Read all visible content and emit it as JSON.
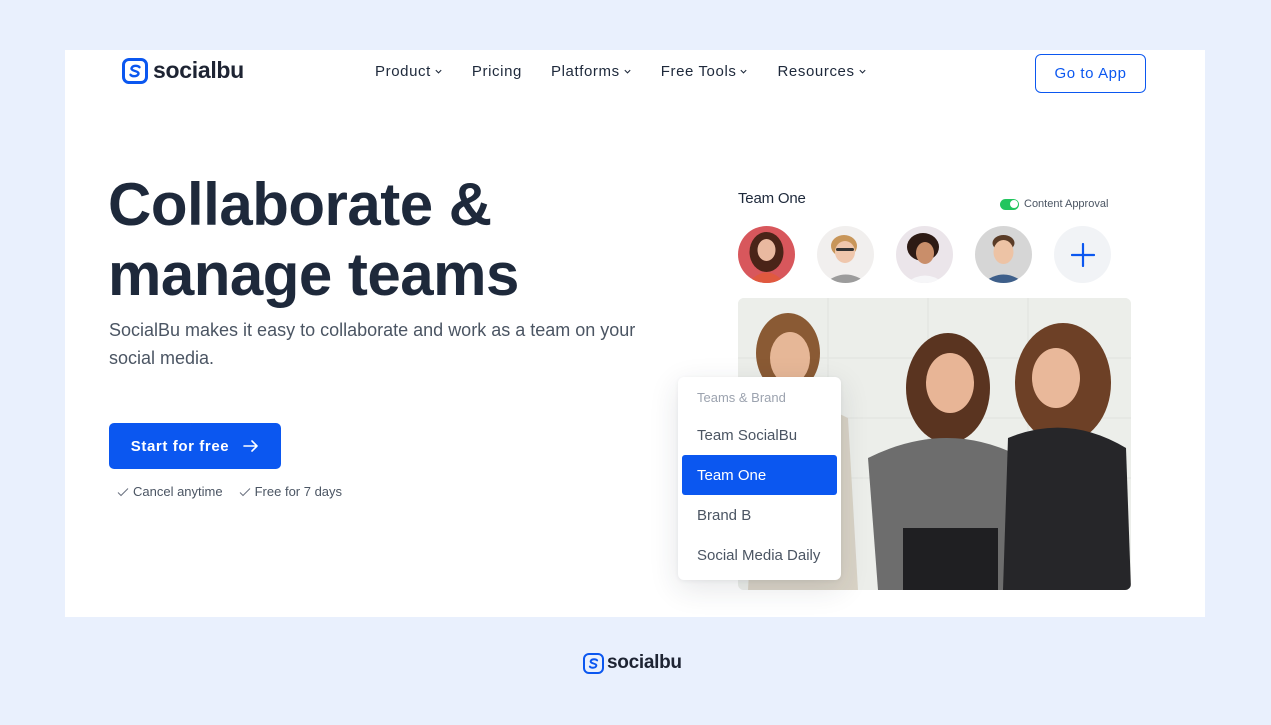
{
  "brand": {
    "name": "socialbu",
    "accent_color": "#0b57f0",
    "logo_icon": "socialbu-s-logo-icon"
  },
  "nav": {
    "items": [
      {
        "label": "Product",
        "has_dropdown": true
      },
      {
        "label": "Pricing",
        "has_dropdown": false
      },
      {
        "label": "Platforms",
        "has_dropdown": true
      },
      {
        "label": "Free Tools",
        "has_dropdown": true
      },
      {
        "label": "Resources",
        "has_dropdown": true
      }
    ],
    "go_to_app_label": "Go to App"
  },
  "hero": {
    "headline_line1": "Collaborate &",
    "headline_line2": "manage teams",
    "subtext": "SocialBu makes it easy to collaborate and work as a team on your social media.",
    "cta_label": "Start for free",
    "cta_icon": "arrow-right-icon",
    "perks": [
      "Cancel anytime",
      "Free for 7 days"
    ]
  },
  "team_panel": {
    "title": "Team One",
    "content_approval_label": "Content Approval",
    "content_approval_enabled": true,
    "toggle_color": "#22c55e",
    "members": [
      {
        "name": "member-1"
      },
      {
        "name": "member-2"
      },
      {
        "name": "member-3"
      },
      {
        "name": "member-4"
      }
    ],
    "add_member_icon": "plus-icon"
  },
  "team_dropdown": {
    "header": "Teams & Brand",
    "items": [
      {
        "label": "Team SocialBu",
        "selected": false
      },
      {
        "label": "Team One",
        "selected": true
      },
      {
        "label": "Brand B",
        "selected": false
      },
      {
        "label": "Social Media Daily",
        "selected": false
      }
    ]
  },
  "footer": {
    "logo_text": "socialbu"
  }
}
